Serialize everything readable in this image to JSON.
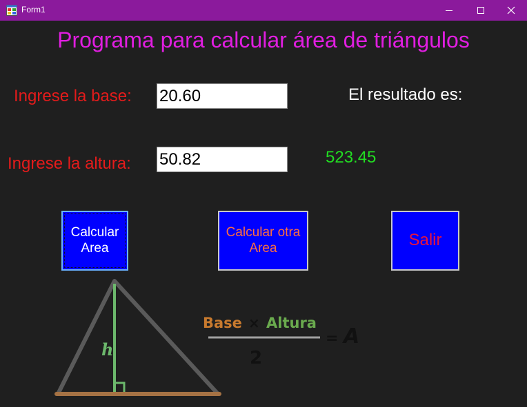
{
  "window": {
    "title": "Form1",
    "minimize_symbol": "—",
    "maximize_symbol": "☐",
    "close_symbol": "✕"
  },
  "heading": "Programa para calcular área de triángulos",
  "base": {
    "label": "Ingrese la base:",
    "value": "20.60"
  },
  "altura": {
    "label": "Ingrese la altura:",
    "value": "50.82"
  },
  "result": {
    "label": "El resultado es:",
    "value": "523.45"
  },
  "buttons": {
    "calcular_line1": "Calcular",
    "calcular_line2": "Area",
    "otra_line1": "Calcular otra",
    "otra_line2": "Area",
    "salir": "Salir"
  },
  "illustration": {
    "height_letter": "h",
    "numerator_base": "Base",
    "times": "×",
    "numerator_altura": "Altura",
    "denominator": "2",
    "equals": "=",
    "area_letter": "A"
  },
  "colors": {
    "titlebar": "#8b1a9c",
    "background": "#1f1f1f",
    "heading": "#e01ee0",
    "labels": "#e41b1b",
    "result_value": "#22dd22",
    "button_fill": "#0000ff"
  },
  "icons": {
    "app": "form-app-icon",
    "minimize": "minimize-icon",
    "maximize": "maximize-icon",
    "close": "close-icon"
  }
}
